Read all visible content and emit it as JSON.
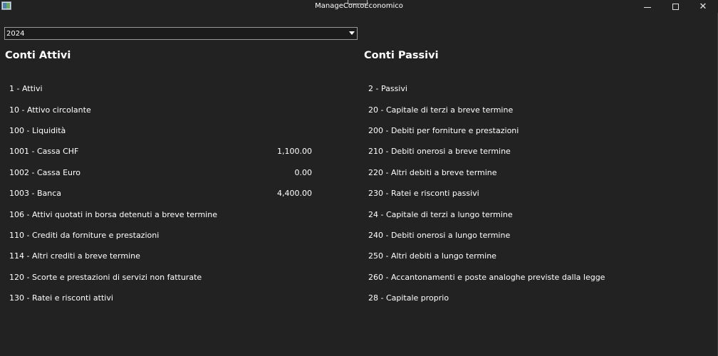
{
  "window": {
    "title": "ManageContoEconomico"
  },
  "caption": {
    "minimize": "—",
    "maximize": "☐",
    "close": "✕"
  },
  "year_selector": {
    "value": "2024"
  },
  "attivi": {
    "title": "Conti Attivi",
    "accounts": [
      {
        "name": "1 - Attivi",
        "amount": ""
      },
      {
        "name": "10 - Attivo circolante",
        "amount": ""
      },
      {
        "name": "100 - Liquidità",
        "amount": ""
      },
      {
        "name": "1001 - Cassa CHF",
        "amount": "1,100.00"
      },
      {
        "name": "1002 - Cassa Euro",
        "amount": "0.00"
      },
      {
        "name": "1003 - Banca",
        "amount": "4,400.00"
      },
      {
        "name": "106 - Attivi quotati in borsa detenuti a breve termine",
        "amount": ""
      },
      {
        "name": "110 - Crediti da forniture e prestazioni",
        "amount": ""
      },
      {
        "name": "114 - Altri crediti a breve termine",
        "amount": ""
      },
      {
        "name": "120 - Scorte e prestazioni di servizi non fatturate",
        "amount": ""
      },
      {
        "name": "130 - Ratei e risconti attivi",
        "amount": ""
      }
    ]
  },
  "passivi": {
    "title": "Conti Passivi",
    "accounts": [
      {
        "name": "2 - Passivi",
        "amount": ""
      },
      {
        "name": "20 - Capitale di terzi a breve termine",
        "amount": ""
      },
      {
        "name": "200 - Debiti per forniture e prestazioni",
        "amount": ""
      },
      {
        "name": "210 - Debiti onerosi a breve termine",
        "amount": ""
      },
      {
        "name": "220 - Altri debiti a breve termine",
        "amount": ""
      },
      {
        "name": "230 - Ratei e risconti passivi",
        "amount": ""
      },
      {
        "name": "24 - Capitale di terzi a lungo termine",
        "amount": ""
      },
      {
        "name": "240 - Debiti onerosi a lungo termine",
        "amount": ""
      },
      {
        "name": "250 - Altri debiti a lungo termine",
        "amount": ""
      },
      {
        "name": "260 - Accantonamenti e poste analoghe previste dalla legge",
        "amount": ""
      },
      {
        "name": "28 - Capitale proprio",
        "amount": ""
      }
    ]
  },
  "colors": {
    "background": "#222222",
    "text": "#ffffff",
    "combo_border": "#9a9a9a"
  }
}
